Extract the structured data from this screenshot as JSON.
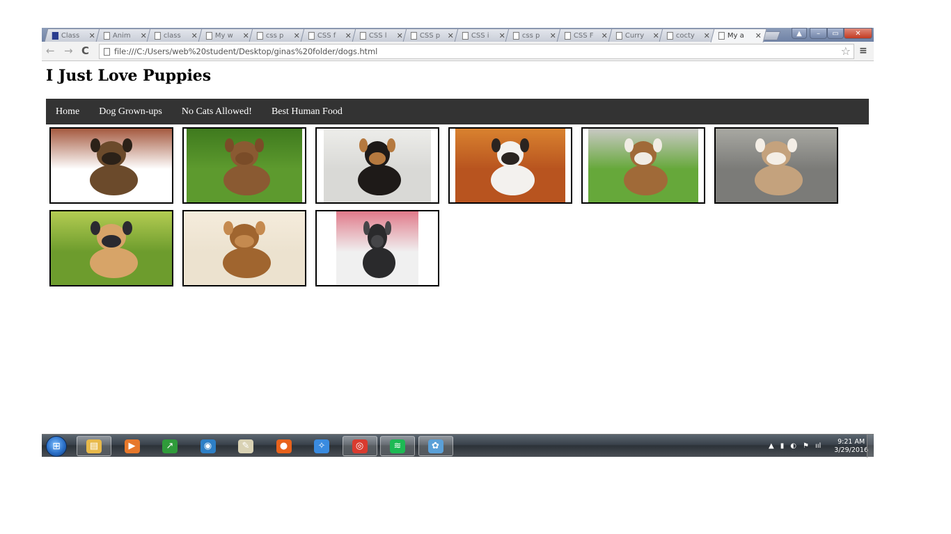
{
  "browser": {
    "tabs": [
      {
        "title": "Class",
        "fav": "m"
      },
      {
        "title": "Anim",
        "fav": "page"
      },
      {
        "title": "class",
        "fav": "page"
      },
      {
        "title": "My w",
        "fav": "page"
      },
      {
        "title": "css p",
        "fav": "page"
      },
      {
        "title": "CSS f",
        "fav": "page"
      },
      {
        "title": "CSS l",
        "fav": "page"
      },
      {
        "title": "CSS p",
        "fav": "page"
      },
      {
        "title": "CSS i",
        "fav": "page"
      },
      {
        "title": "css p",
        "fav": "page"
      },
      {
        "title": "CSS F",
        "fav": "page"
      },
      {
        "title": "Curry",
        "fav": "page"
      },
      {
        "title": "cocty",
        "fav": "page"
      },
      {
        "title": "My a",
        "fav": "page",
        "active": true
      }
    ],
    "close_glyph": "✕",
    "url": "file:///C:/Users/web%20student/Desktop/ginas%20folder/dogs.html",
    "icons": {
      "back": "←",
      "forward": "→",
      "reload": "C",
      "star": "☆",
      "menu": "≡",
      "minimize": "–",
      "maximize": "▭",
      "close": "✕",
      "user": "▲"
    }
  },
  "page": {
    "title": "I Just Love Puppies",
    "nav": [
      "Home",
      "Dog Grown-ups",
      "No Cats Allowed!",
      "Best Human Food"
    ],
    "images": [
      {
        "name": "yorkie-in-cup-photo",
        "bg": "#ffffff",
        "dog": "#6b4a2b",
        "dog2": "#2b2118",
        "accent": "#a55a40"
      },
      {
        "name": "two-dachshunds-photo",
        "bg": "#5d9a2e",
        "dog": "#8a5a32",
        "dog2": "#7a4c28",
        "accent": "#3f7a1e"
      },
      {
        "name": "chihuahua-on-stairs-photo",
        "bg": "#d9d9d6",
        "dog": "#1e1a18",
        "dog2": "#b5793f",
        "accent": "#ededea"
      },
      {
        "name": "saint-bernard-in-leaves-photo",
        "bg": "#b8541f",
        "dog": "#f3f1ee",
        "dog2": "#2a2420",
        "accent": "#d9822f"
      },
      {
        "name": "beagle-on-grass-photo",
        "bg": "#66a83a",
        "dog": "#a06a38",
        "dog2": "#f0ece4",
        "accent": "#c9c9c4"
      },
      {
        "name": "husky-puppy-on-rock-photo",
        "bg": "#7b7b78",
        "dog": "#c4a27d",
        "dog2": "#f4eee6",
        "accent": "#a8a8a2"
      },
      {
        "name": "two-corgis-on-grass-photo",
        "bg": "#6d9c2d",
        "dog": "#d7a468",
        "dog2": "#2a2a30",
        "accent": "#b4cc52"
      },
      {
        "name": "puppy-sleeping-in-sand-photo",
        "bg": "#ece2cf",
        "dog": "#a0652f",
        "dog2": "#c58a4f",
        "accent": "#f5ecdc"
      },
      {
        "name": "black-pug-photo",
        "bg": "#f0f0f0",
        "dog": "#2a2a2c",
        "dog2": "#454548",
        "accent": "#e07a8a"
      }
    ]
  },
  "taskbar": {
    "apps": [
      {
        "name": "windows-explorer-taskbar-button",
        "glyph": "▤",
        "color": "#e8b94a",
        "open": true
      },
      {
        "name": "media-player-taskbar-button",
        "glyph": "▶",
        "color": "#e7782b",
        "open": false
      },
      {
        "name": "finance-app-taskbar-button",
        "glyph": "↗",
        "color": "#2f9b3a",
        "open": false
      },
      {
        "name": "network-app-taskbar-button",
        "glyph": "◉",
        "color": "#2d7fc6",
        "open": false
      },
      {
        "name": "notepad-taskbar-button",
        "glyph": "✎",
        "color": "#d9d2b4",
        "open": false
      },
      {
        "name": "firefox-taskbar-button",
        "glyph": "●",
        "color": "#e8621c",
        "open": false
      },
      {
        "name": "safari-taskbar-button",
        "glyph": "✧",
        "color": "#3a8be0",
        "open": false
      },
      {
        "name": "chrome-taskbar-button",
        "glyph": "◎",
        "color": "#d93b2f",
        "open": true
      },
      {
        "name": "spotify-taskbar-button",
        "glyph": "≋",
        "color": "#1db954",
        "open": true
      },
      {
        "name": "paint-taskbar-button",
        "glyph": "✿",
        "color": "#5aa0d8",
        "open": true
      }
    ],
    "start_glyph": "⊞",
    "tray_icons": [
      "▲",
      "▮",
      "◐",
      "⚑",
      "ııl"
    ],
    "time": "9:21 AM",
    "date": "3/29/2016"
  }
}
